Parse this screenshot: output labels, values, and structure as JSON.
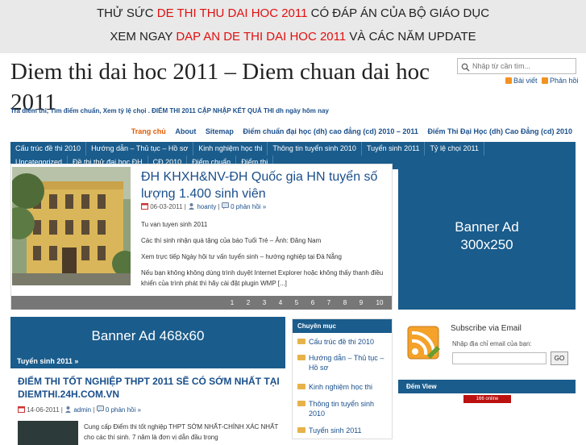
{
  "top_banner": {
    "line1_prefix": "THỬ SỨC",
    "line1_highlight": "DE THI THU DAI HOC 2011",
    "line1_suffix": "CÓ ĐÁP ÁN CỦA BỘ GIÁO DỤC",
    "line2_prefix": "XEM NGAY",
    "line2_highlight": "DAP AN DE THI DAI HOC 2011",
    "line2_suffix": "VÀ CÁC NĂM UPDATE",
    "highlight_color": "#e01010"
  },
  "site": {
    "title": "Diem thi dai hoc 2011 – Diem chuan dai hoc 2011",
    "tagline": "Tra điểm thi, Tìm điểm chuẩn, Xem tỷ lệ chọi . ĐIỂM THI 2011 CẬP NHẬP KẾT QUẢ THI dh ngày hôm nay"
  },
  "search": {
    "placeholder": "Nhập từ cần tìm..."
  },
  "feeds": {
    "posts": "Bài viết",
    "comments": "Phản hồi"
  },
  "pages_nav": [
    "Trang chủ",
    "About",
    "Sitemap",
    "Điểm chuẩn đại học (dh) cao đẳng (cd) 2010 – 2011",
    "Điểm Thi Đại Học (dh) Cao Đẳng (cd) 2010"
  ],
  "category_nav": {
    "row1": [
      "Cấu trúc đề thi 2010",
      "Hướng dẫn – Thủ tục – Hồ sơ",
      "Kinh nghiệm học thi",
      "Thông tin tuyển sinh 2010",
      "Tuyển sinh 2011",
      "Tỷ lệ chọi 2011"
    ],
    "row2": [
      "Uncategorized",
      "Đề thi thử đại học ĐH",
      "CĐ 2010",
      "Điểm chuẩn",
      "Điểm thi"
    ]
  },
  "featured": {
    "title": "ĐH KHXH&NV-ĐH Quốc gia HN tuyển số lượng 1.400 sinh viên",
    "date": "06-03-2011",
    "author": "hoanty",
    "comments": "0 phản hồi »",
    "p1": "Tu van tuyen sinh 2011",
    "p2": "Các thí sinh nhận quà tặng của báo Tuổi Trẻ – Ảnh: Đăng Nam",
    "p3": "Xem trực tiếp Ngày hội tư vấn tuyển sinh – hướng nghiệp tại Đà Nẵng",
    "p4": "Nếu bạn không không dùng trình duyệt Internet Explorer hoặc không thấy thanh điều khiển của trình phát thì hãy cài đặt plugin WMP [...]",
    "pager": [
      "1",
      "2",
      "3",
      "4",
      "5",
      "6",
      "7",
      "8",
      "9",
      "10"
    ]
  },
  "banner_300": {
    "line1": "Banner Ad",
    "line2": "300x250"
  },
  "banner_468": {
    "label": "Banner Ad 468x60"
  },
  "section": {
    "title": "Tuyển sinh 2011 »"
  },
  "post2": {
    "title": "ĐIỂM THI TỐT NGHIỆP THPT 2011 SẼ CÓ SỚM NHẤT TẠI DIEMTHI.24H.COM.VN",
    "date": "14-06-2011",
    "author": "admin",
    "comments": "0 phản hồi »",
    "excerpt": "Cung cấp Điểm thi tốt nghiệp THPT SỚM NHẤT-CHÍNH XÁC NHẤT cho các thí sinh. 7 năm là đơn vị dẫn đầu trong"
  },
  "categories": {
    "title": "Chuyên mục",
    "items": [
      "Cấu trúc đề thi 2010",
      "Hướng dẫn – Thủ tục – Hồ sơ",
      "Kinh nghiệm học thi",
      "Thông tin tuyển sinh 2010",
      "Tuyển sinh 2011"
    ]
  },
  "subscribe": {
    "title": "Subscribe via Email",
    "label": "Nhập địa chỉ email của bạn:",
    "button": "GO"
  },
  "dem_view": {
    "title": "Đếm View",
    "counter": "166 online"
  },
  "colors": {
    "primary": "#1a5c8c",
    "link": "#1a4f8b",
    "accent": "#e25a00"
  }
}
